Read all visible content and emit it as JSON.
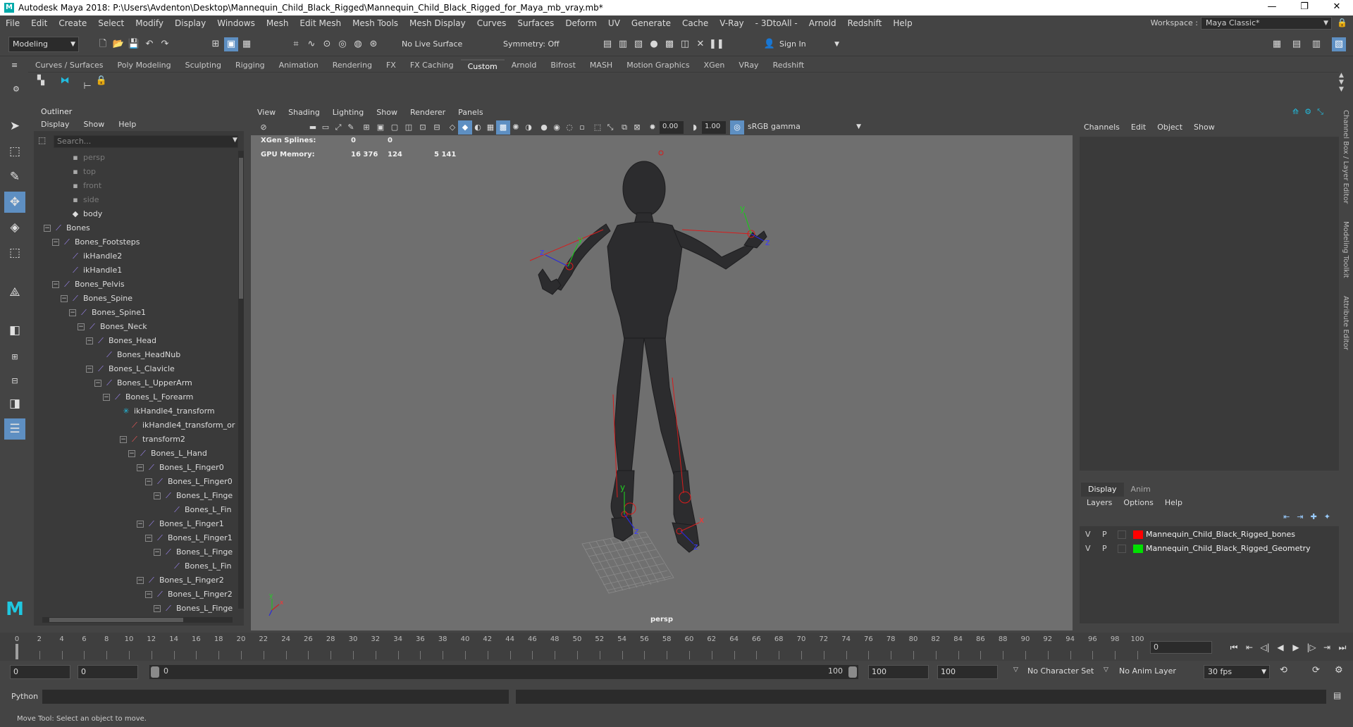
{
  "window": {
    "title": "Autodesk Maya 2018: P:\\Users\\Avdenton\\Desktop\\Mannequin_Child_Black_Rigged\\Mannequin_Child_Black_Rigged_for_Maya_mb_vray.mb*",
    "minimize": "—",
    "maximize": "❐",
    "close": "✕"
  },
  "menubar": {
    "items": [
      "File",
      "Edit",
      "Create",
      "Select",
      "Modify",
      "Display",
      "Windows",
      "Mesh",
      "Edit Mesh",
      "Mesh Tools",
      "Mesh Display",
      "Curves",
      "Surfaces",
      "Deform",
      "UV",
      "Generate",
      "Cache",
      "V-Ray",
      "- 3DtoAll -",
      "Arnold",
      "Redshift",
      "Help"
    ],
    "workspace_label": "Workspace :",
    "workspace_value": "Maya Classic*"
  },
  "statusline": {
    "menuset": "Modeling",
    "live_surface": "No Live Surface",
    "symmetry": "Symmetry: Off",
    "sign_in": "Sign In"
  },
  "shelf": {
    "tabs": [
      "Curves / Surfaces",
      "Poly Modeling",
      "Sculpting",
      "Rigging",
      "Animation",
      "Rendering",
      "FX",
      "FX Caching",
      "Custom",
      "Arnold",
      "Bifrost",
      "MASH",
      "Motion Graphics",
      "XGen",
      "VRay",
      "Redshift"
    ],
    "active": "Custom"
  },
  "outliner": {
    "title": "Outliner",
    "menu": [
      "Display",
      "Show",
      "Help"
    ],
    "search_placeholder": "Search...",
    "rows": [
      {
        "label": "persp",
        "kind": "cam"
      },
      {
        "label": "top",
        "kind": "cam"
      },
      {
        "label": "front",
        "kind": "cam"
      },
      {
        "label": "side",
        "kind": "cam"
      },
      {
        "label": "body",
        "kind": "mesh"
      },
      {
        "label": "Bones",
        "kind": "joint"
      },
      {
        "label": "Bones_Footsteps",
        "kind": "joint"
      },
      {
        "label": "ikHandle2",
        "kind": "ik"
      },
      {
        "label": "ikHandle1",
        "kind": "ik"
      },
      {
        "label": "Bones_Pelvis",
        "kind": "joint"
      },
      {
        "label": "Bones_Spine",
        "kind": "joint"
      },
      {
        "label": "Bones_Spine1",
        "kind": "joint"
      },
      {
        "label": "Bones_Neck",
        "kind": "joint"
      },
      {
        "label": "Bones_Head",
        "kind": "joint"
      },
      {
        "label": "Bones_HeadNub",
        "kind": "joint"
      },
      {
        "label": "Bones_L_Clavicle",
        "kind": "joint"
      },
      {
        "label": "Bones_L_UpperArm",
        "kind": "joint"
      },
      {
        "label": "Bones_L_Forearm",
        "kind": "joint"
      },
      {
        "label": "ikHandle4_transform",
        "kind": "xform"
      },
      {
        "label": "ikHandle4_transform_or",
        "kind": "constraint"
      },
      {
        "label": "transform2",
        "kind": "constraint"
      },
      {
        "label": "Bones_L_Hand",
        "kind": "joint"
      },
      {
        "label": "Bones_L_Finger0",
        "kind": "joint"
      },
      {
        "label": "Bones_L_Finger0",
        "kind": "joint"
      },
      {
        "label": "Bones_L_Finge",
        "kind": "joint"
      },
      {
        "label": "Bones_L_Fin",
        "kind": "joint"
      },
      {
        "label": "Bones_L_Finger1",
        "kind": "joint"
      },
      {
        "label": "Bones_L_Finger1",
        "kind": "joint"
      },
      {
        "label": "Bones_L_Finge",
        "kind": "joint"
      },
      {
        "label": "Bones_L_Fin",
        "kind": "joint"
      },
      {
        "label": "Bones_L_Finger2",
        "kind": "joint"
      },
      {
        "label": "Bones_L_Finger2",
        "kind": "joint"
      },
      {
        "label": "Bones_L_Finge",
        "kind": "joint"
      }
    ]
  },
  "viewport": {
    "menu": [
      "View",
      "Shading",
      "Lighting",
      "Show",
      "Renderer",
      "Panels"
    ],
    "exposure": "0.00",
    "gamma": "1.00",
    "color_space": "sRGB gamma",
    "hud": [
      {
        "label": "XGen Splines:",
        "v1": "0",
        "v2": "0",
        "v3": ""
      },
      {
        "label": "GPU Memory:",
        "v1": "16 376",
        "v2": "124",
        "v3": "5 141"
      }
    ],
    "camera": "persp",
    "axis_labels": {
      "x": "x",
      "y": "y",
      "z": "z"
    }
  },
  "channelbox": {
    "menu": [
      "Channels",
      "Edit",
      "Object",
      "Show"
    ],
    "side_tabs": [
      "Channel Box / Layer Editor",
      "Modeling Toolkit",
      "Attribute Editor"
    ]
  },
  "layereditor": {
    "tabs": [
      "Display",
      "Anim"
    ],
    "menu": [
      "Layers",
      "Options",
      "Help"
    ],
    "layers": [
      {
        "v": "V",
        "p": "P",
        "color": "#ff0000",
        "name": "Mannequin_Child_Black_Rigged_bones"
      },
      {
        "v": "V",
        "p": "P",
        "color": "#00e000",
        "name": "Mannequin_Child_Black_Rigged_Geometry"
      }
    ]
  },
  "timeslider": {
    "ticks": [
      "0",
      "2",
      "4",
      "6",
      "8",
      "10",
      "12",
      "14",
      "16",
      "18",
      "20",
      "22",
      "24",
      "26",
      "28",
      "30",
      "32",
      "34",
      "36",
      "38",
      "40",
      "42",
      "44",
      "46",
      "48",
      "50",
      "52",
      "54",
      "56",
      "58",
      "60",
      "62",
      "64",
      "66",
      "68",
      "70",
      "72",
      "74",
      "76",
      "78",
      "80",
      "82",
      "84",
      "86",
      "88",
      "90",
      "92",
      "94",
      "96",
      "98",
      "100"
    ],
    "current_frame": "0"
  },
  "rangeslider": {
    "start": "0",
    "playback_start": "0",
    "range_left": "0",
    "range_right": "100",
    "playback_end": "100",
    "end": "100",
    "character_set": "No Character Set",
    "anim_layer": "No Anim Layer",
    "fps": "30 fps"
  },
  "cmdline": {
    "language": "Python"
  },
  "helpline": {
    "text": "Move Tool: Select an object to move."
  }
}
